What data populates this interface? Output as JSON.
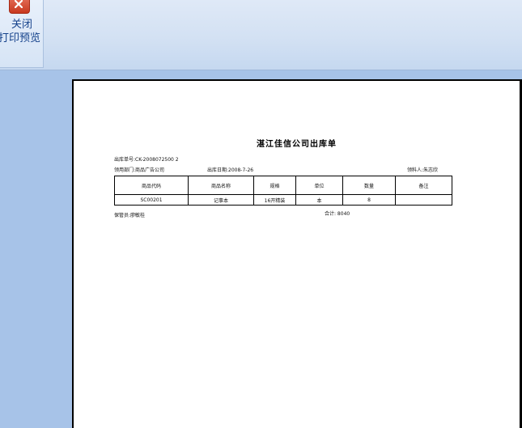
{
  "toolbar": {
    "close_label_line1": "关闭",
    "close_label_line2": "打印预览"
  },
  "report": {
    "title": "湛江佳信公司出库单",
    "doc_no": "出库单号:CK-2008072500 2",
    "dept": "领用部门:商品广告公司",
    "date": "出库日期:2008-7-26",
    "receiver": "领料人:朱志欣",
    "columns": [
      "商品代码",
      "商品名称",
      "规格",
      "单位",
      "数量",
      "备注"
    ],
    "rows": [
      [
        "SC00201",
        "记事本",
        "16开精装",
        "本",
        "8",
        ""
      ]
    ],
    "keeper": "保管员:廖敏桂",
    "total": "合计: 8040"
  }
}
